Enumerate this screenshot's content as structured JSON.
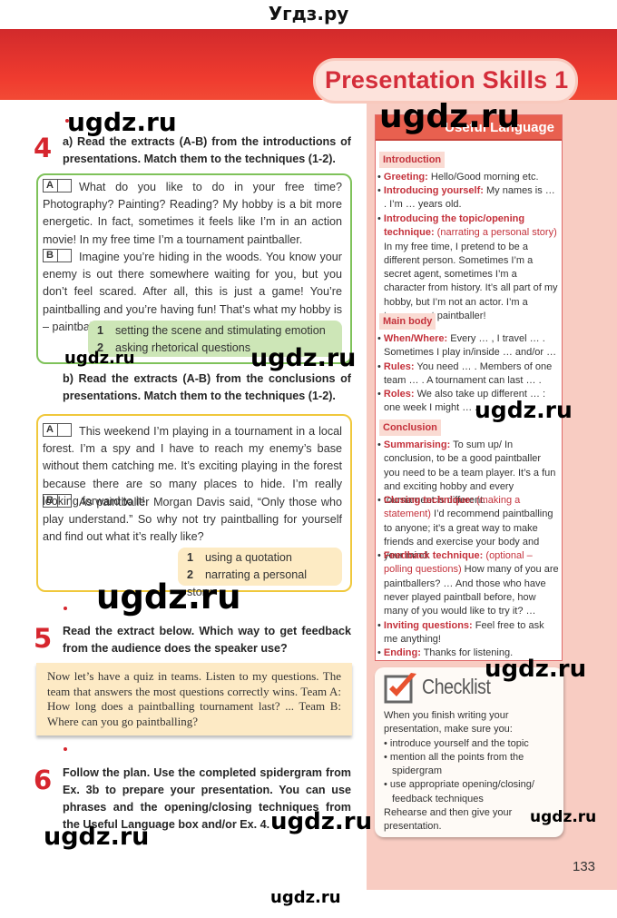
{
  "site_title": "Угдз.ру",
  "chapter_title": "Presentation Skills 1",
  "page_number": "133",
  "watermark": "ugdz.ru",
  "exercise4": {
    "number": "4",
    "part_a": {
      "instruction": "a)  Read the extracts (A-B) from the introductions of presentations. Match them to the techniques (1-2).",
      "extracts": [
        {
          "letter": "A",
          "text": "What do you like to do in your free time? Photography? Painting? Reading? My hobby is a bit more energetic. In fact, sometimes it feels like I’m in an action movie! In my free time I’m a tournament paintballer."
        },
        {
          "letter": "B",
          "text": "Imagine you’re hiding in the woods. You know your enemy is out there somewhere waiting for you, but you don’t feel scared. After all, this is just a game! You’re paintballing and you’re having fun! That’s what my hobby is – paintballing."
        }
      ],
      "techniques": [
        {
          "num": "1",
          "text": "setting the scene and stimulating emotion"
        },
        {
          "num": "2",
          "text": "asking rhetorical questions"
        }
      ]
    },
    "part_b": {
      "instruction": "b)  Read the extracts (A-B) from the conclusions of presentations. Match them to the techniques (1-2).",
      "extracts": [
        {
          "letter": "A",
          "text": "This weekend I’m playing in a tournament in a local forest. I’m a spy and I have to reach my enemy’s base without them catching me. It’s exciting playing in the forest because there are so many places to hide. I’m really looking forward to it!"
        },
        {
          "letter": "B",
          "text": "As paintballer Morgan Davis said, “Only those who play understand.” So why not try paintballing for yourself and find out what it’s really like?"
        }
      ],
      "techniques": [
        {
          "num": "1",
          "text": "using a quotation"
        },
        {
          "num": "2",
          "text": "narrating a personal story"
        }
      ]
    }
  },
  "exercise5": {
    "number": "5",
    "instruction": "Read the extract below. Which way to get feedback from the audience does the speaker use?",
    "extract": "Now let’s have a quiz in teams. Listen to my questions. The team that answers the most questions correctly wins. Team A: How long does a paintballing tournament last? ... Team B: Where can you go paintballing?"
  },
  "exercise6": {
    "number": "6",
    "instruction": "Follow the plan. Use the completed spidergram from Ex. 3b to prepare your presentation. You can use phrases and the opening/closing techniques from the Useful Language box and/or Ex. 4."
  },
  "useful_language": {
    "title": "Useful Language",
    "sections": [
      {
        "heading": "Introduction",
        "items": [
          {
            "key": "Greeting:",
            "hint": "",
            "text": " Hello/Good morning etc."
          },
          {
            "key": "Introducing yourself:",
            "hint": "",
            "text": " My names is … . I’m … years old."
          },
          {
            "key": "Introducing the topic/opening technique:",
            "hint": " (narrating a personal story)",
            "text": " In my free time, I pretend to be a different person. Sometimes I’m a secret agent, sometimes I’m a character from history. It’s all part of my hobby, but I’m not an actor. I’m a tournament paintballer!"
          }
        ]
      },
      {
        "heading": "Main body",
        "items": [
          {
            "key": "When/Where:",
            "hint": "",
            "text": " Every … , I travel … . Sometimes I play in/inside … and/or … ."
          },
          {
            "key": "Rules:",
            "hint": "",
            "text": " You need … . Members of one team … . A tournament can last … ."
          },
          {
            "key": "Roles:",
            "hint": "",
            "text": " We also take up different … : one week I might … ."
          }
        ]
      },
      {
        "heading": "Conclusion",
        "items": [
          {
            "key": "Summarising:",
            "hint": "",
            "text": " To sum up/ In conclusion, to be a good paintballer you need to be a team player. It’s a fun and exciting hobby and every tournament is different."
          },
          {
            "key": "Closing technique:",
            "hint": " (making a statement)",
            "text": " I’d recommend paintballing to anyone; it’s a great way to make friends and exercise your body and your mind."
          },
          {
            "key": "Feedback technique:",
            "hint": " (optional – polling questions)",
            "text": " How many of you are paintballers? … And those who have never played paintball before, how many of you would like to try it? …"
          },
          {
            "key": "Inviting questions:",
            "hint": "",
            "text": " Feel free to ask me anything!"
          },
          {
            "key": "Ending:",
            "hint": "",
            "text": " Thanks for listening."
          }
        ]
      }
    ]
  },
  "checklist": {
    "title": "Checklist",
    "icon": "checkbox-checkmark-icon",
    "intro": "When you finish writing your presentation, make sure you:",
    "items": [
      "introduce yourself and the topic",
      "mention all the points from the spidergram",
      "use appropriate opening/closing/ feedback techniques"
    ],
    "outro": "Rehearse and then give your presentation."
  },
  "colors": {
    "banner_red": "#e8302e",
    "accent_red": "#d6262e",
    "green_border": "#7fc25a",
    "yellow_border": "#f0c83c",
    "sidebar_pink": "#f8ccc2"
  }
}
